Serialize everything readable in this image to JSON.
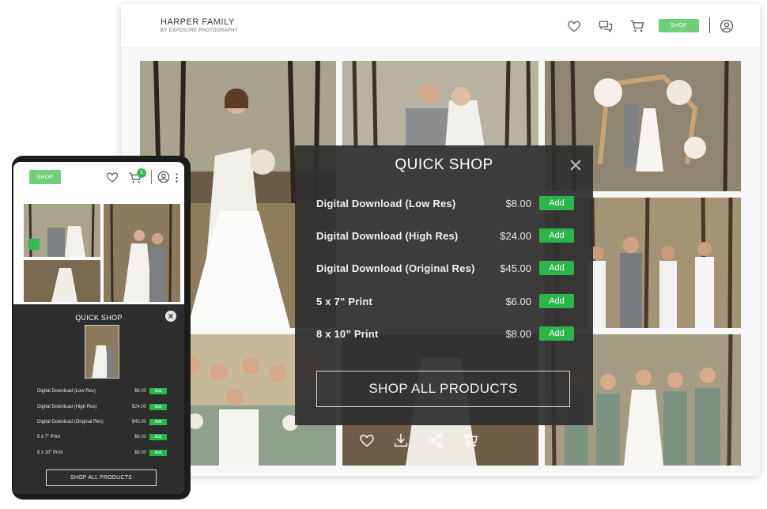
{
  "site": {
    "title": "HARPER FAMILY",
    "subtitle": "BY EXPOSURE PHOTOGRAPHY",
    "shop_label": "SHOP"
  },
  "header_icons": [
    "heart-icon",
    "chat-icon",
    "cart-icon",
    "account-icon"
  ],
  "quick_shop": {
    "title": "QUICK SHOP",
    "add_label": "Add",
    "shop_all_label": "SHOP ALL PRODUCTS",
    "products": [
      {
        "name": "Digital Download (Low Res)",
        "price": "$8.00"
      },
      {
        "name": "Digital Download (High Res)",
        "price": "$24.00"
      },
      {
        "name": "Digital Download (Original Res)",
        "price": "$45.00"
      },
      {
        "name": "5 x 7” Print",
        "price": "$6.00"
      },
      {
        "name": "8 x 10” Print",
        "price": "$8.00"
      }
    ]
  },
  "photo_actions": [
    "heart-icon",
    "download-icon",
    "share-icon",
    "cart-icon"
  ],
  "mobile": {
    "shop_label": "SHOP",
    "cart_count": "5",
    "quick_shop": {
      "title": "QUICK SHOP",
      "add_label": "Add",
      "shop_all_label": "SHOP ALL PRODUCTS",
      "products": [
        {
          "name": "Digital Download (Low Res)",
          "price": "$8.00"
        },
        {
          "name": "Digital Download (High Res)",
          "price": "$24.00"
        },
        {
          "name": "Digital Download (Original Res)",
          "price": "$45.00"
        },
        {
          "name": "5 x 7” Print",
          "price": "$6.00"
        },
        {
          "name": "8 x 10” Print",
          "price": "$8.00"
        }
      ]
    }
  },
  "colors": {
    "accent_green": "#2cb54a",
    "shop_button": "#6fcf7a",
    "overlay": "#303030"
  }
}
